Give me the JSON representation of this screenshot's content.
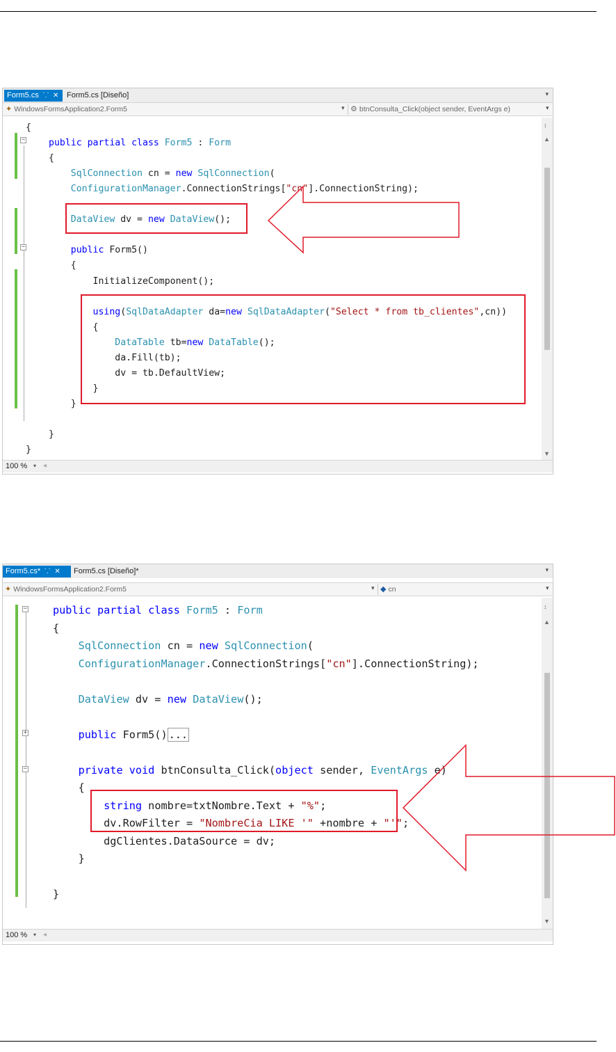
{
  "colors": {
    "keyword": "#0000ff",
    "type": "#2b91af",
    "string": "#a31515",
    "text": "#1e1e1e",
    "tab_active": "#007acc",
    "highlight_red": "#e01a2a",
    "changed_green": "#6cc04a"
  },
  "screenshot1": {
    "tab_active": "Form5.cs",
    "tab_inactive": "Form5.cs [Diseño]",
    "pin_icon": "pin-icon",
    "close_icon": "close-icon",
    "nav_class": "WindowsFormsApplication2.Form5",
    "nav_member": "btnConsulta_Click(object sender, EventArgs e)",
    "zoom": "100 %",
    "lines": [
      [
        {
          "t": "{"
        }
      ],
      [
        {
          "t": "public partial class ",
          "c": "kw"
        },
        {
          "t": "Form5",
          "c": "ty"
        },
        {
          "t": " : "
        },
        {
          "t": "Form",
          "c": "ty"
        }
      ],
      [
        {
          "t": "{"
        }
      ],
      [
        {
          "t": "    "
        },
        {
          "t": "SqlConnection",
          "c": "ty"
        },
        {
          "t": " cn = "
        },
        {
          "t": "new ",
          "c": "kw"
        },
        {
          "t": "SqlConnection",
          "c": "ty"
        },
        {
          "t": "("
        }
      ],
      [
        {
          "t": "    "
        },
        {
          "t": "ConfigurationManager",
          "c": "ty"
        },
        {
          "t": ".ConnectionStrings["
        },
        {
          "t": "\"cn\"",
          "c": "st"
        },
        {
          "t": "].ConnectionString);"
        }
      ],
      [
        {
          "t": ""
        }
      ],
      [
        {
          "t": "    "
        },
        {
          "t": "DataView",
          "c": "ty"
        },
        {
          "t": " dv = "
        },
        {
          "t": "new ",
          "c": "kw"
        },
        {
          "t": "DataView",
          "c": "ty"
        },
        {
          "t": "();"
        }
      ],
      [
        {
          "t": ""
        }
      ],
      [
        {
          "t": "    "
        },
        {
          "t": "public ",
          "c": "kw"
        },
        {
          "t": "Form5()"
        }
      ],
      [
        {
          "t": "    {"
        }
      ],
      [
        {
          "t": "        InitializeComponent();"
        }
      ],
      [
        {
          "t": ""
        }
      ],
      [
        {
          "t": "        "
        },
        {
          "t": "using",
          "c": "kw"
        },
        {
          "t": "("
        },
        {
          "t": "SqlDataAdapter",
          "c": "ty"
        },
        {
          "t": " da="
        },
        {
          "t": "new ",
          "c": "kw"
        },
        {
          "t": "SqlDataAdapter",
          "c": "ty"
        },
        {
          "t": "("
        },
        {
          "t": "\"Select * from tb_clientes\"",
          "c": "st"
        },
        {
          "t": ",cn))"
        }
      ],
      [
        {
          "t": "        {"
        }
      ],
      [
        {
          "t": "            "
        },
        {
          "t": "DataTable",
          "c": "ty"
        },
        {
          "t": " tb="
        },
        {
          "t": "new ",
          "c": "kw"
        },
        {
          "t": "DataTable",
          "c": "ty"
        },
        {
          "t": "();"
        }
      ],
      [
        {
          "t": "            da.Fill(tb);"
        }
      ],
      [
        {
          "t": "            dv = tb.DefaultView;"
        }
      ],
      [
        {
          "t": "        }"
        }
      ],
      [
        {
          "t": "    }"
        }
      ],
      [
        {
          "t": ""
        }
      ],
      [
        {
          "t": "}"
        }
      ],
      [
        {
          "t": "}"
        }
      ]
    ]
  },
  "screenshot2": {
    "tab_active": "Form5.cs*",
    "tab_inactive": "Form5.cs [Diseño]*",
    "pin_icon": "pin-icon",
    "close_icon": "close-icon",
    "nav_class": "WindowsFormsApplication2.Form5",
    "nav_member": "cn",
    "zoom": "100 %",
    "lines": [
      [
        {
          "t": "public partial class ",
          "c": "kw"
        },
        {
          "t": "Form5",
          "c": "ty"
        },
        {
          "t": " : "
        },
        {
          "t": "Form",
          "c": "ty"
        }
      ],
      [
        {
          "t": "{"
        }
      ],
      [
        {
          "t": "    "
        },
        {
          "t": "SqlConnection",
          "c": "ty"
        },
        {
          "t": " cn = "
        },
        {
          "t": "new ",
          "c": "kw"
        },
        {
          "t": "SqlConnection",
          "c": "ty"
        },
        {
          "t": "("
        }
      ],
      [
        {
          "t": "    "
        },
        {
          "t": "ConfigurationManager",
          "c": "ty"
        },
        {
          "t": ".ConnectionStrings["
        },
        {
          "t": "\"cn\"",
          "c": "st"
        },
        {
          "t": "].ConnectionString);"
        }
      ],
      [
        {
          "t": ""
        }
      ],
      [
        {
          "t": "    "
        },
        {
          "t": "DataView",
          "c": "ty"
        },
        {
          "t": " dv = "
        },
        {
          "t": "new ",
          "c": "kw"
        },
        {
          "t": "DataView",
          "c": "ty"
        },
        {
          "t": "();"
        }
      ],
      [
        {
          "t": ""
        }
      ],
      [
        {
          "t": "    "
        },
        {
          "t": "public ",
          "c": "kw"
        },
        {
          "t": "Form5()"
        },
        {
          "t": "...",
          "box": true
        }
      ],
      [
        {
          "t": ""
        }
      ],
      [
        {
          "t": "    "
        },
        {
          "t": "private void ",
          "c": "kw"
        },
        {
          "t": "btnConsulta_Click("
        },
        {
          "t": "object ",
          "c": "kw"
        },
        {
          "t": "sender, "
        },
        {
          "t": "EventArgs",
          "c": "ty"
        },
        {
          "t": " e)"
        }
      ],
      [
        {
          "t": "    {"
        }
      ],
      [
        {
          "t": "        "
        },
        {
          "t": "string ",
          "c": "kw"
        },
        {
          "t": "nombre=txtNombre.Text + "
        },
        {
          "t": "\"%\"",
          "c": "st"
        },
        {
          "t": ";"
        }
      ],
      [
        {
          "t": "        dv.RowFilter = "
        },
        {
          "t": "\"NombreCia LIKE '\"",
          "c": "st"
        },
        {
          "t": " +nombre + "
        },
        {
          "t": "\"'\"",
          "c": "st"
        },
        {
          "t": ";"
        }
      ],
      [
        {
          "t": "        dgClientes.DataSource = dv;"
        }
      ],
      [
        {
          "t": "    }"
        }
      ],
      [
        {
          "t": ""
        }
      ],
      [
        {
          "t": "}"
        }
      ]
    ]
  }
}
